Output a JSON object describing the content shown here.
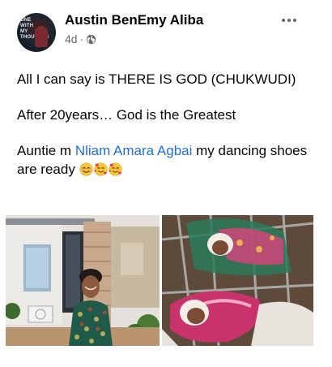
{
  "post": {
    "author": "Austin BenEmy Aliba",
    "time": "4d",
    "avatar_text": "ONE\nWITH\nMY\nTHOUGHTS",
    "paragraphs": {
      "p1": "All I can say is THERE IS GOD (CHUKWUDI)",
      "p2": "After 20years… God is the Greatest",
      "p3_before": "Auntie m ",
      "p3_mention": "Nliam Amara Agbai",
      "p3_after": " my dancing shoes are ready "
    },
    "emojis": [
      "smiling-face-with-smiling-eyes",
      "smiling-face-with-hearts",
      "smiling-face-with-hearts"
    ],
    "photos": [
      {
        "name": "woman-standing-outside-house"
      },
      {
        "name": "newborn-twins-in-crib"
      }
    ]
  },
  "colors": {
    "text": "#050505",
    "secondary": "#65676b",
    "link": "#216fdb"
  },
  "icons": {
    "privacy": "globe-icon",
    "menu": "more-options-icon"
  }
}
